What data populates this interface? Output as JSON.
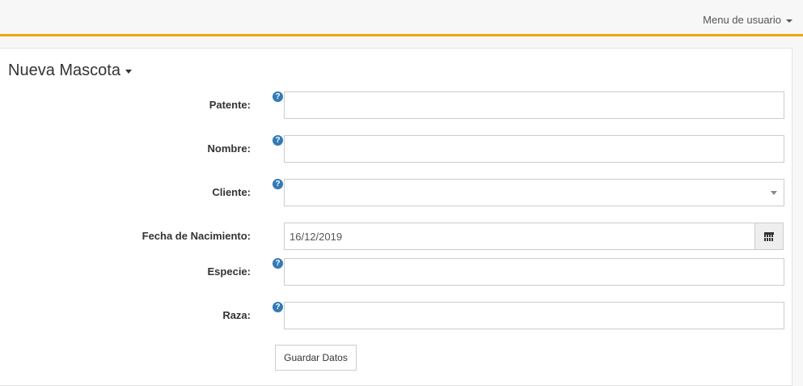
{
  "header": {
    "user_menu_label": "Menu de usuario",
    "accent_color": "#f0a30a"
  },
  "form": {
    "title": "Nueva Mascota",
    "fields": [
      {
        "label": "Patente:",
        "value": "",
        "type": "text",
        "help_icon": "question-circle-icon"
      },
      {
        "label": "Nombre:",
        "value": "",
        "type": "text",
        "help_icon": "question-circle-icon"
      },
      {
        "label": "Cliente:",
        "value": "",
        "type": "select",
        "help_icon": "question-circle-icon"
      },
      {
        "label": "Fecha de Nacimiento:",
        "value": "16/12/2019",
        "type": "date",
        "icon": "calendar-icon"
      },
      {
        "label": "Especie:",
        "value": "",
        "type": "text",
        "help_icon": "question-circle-icon"
      },
      {
        "label": "Raza:",
        "value": "",
        "type": "text",
        "help_icon": "question-circle-icon"
      }
    ],
    "submit_label": "Guardar Datos"
  }
}
